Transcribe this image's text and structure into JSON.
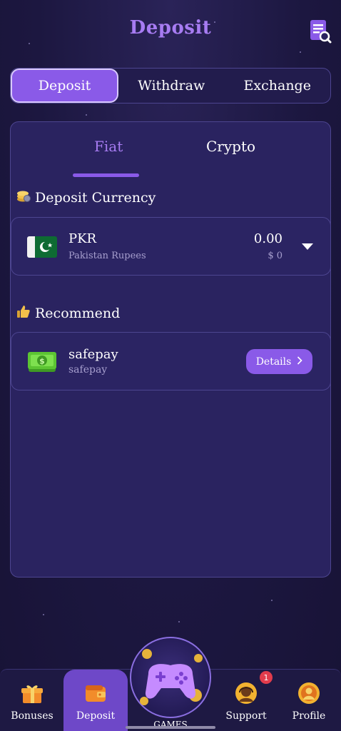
{
  "header": {
    "title": "Deposit",
    "history_icon": "history-search-icon"
  },
  "top_tabs": [
    {
      "label": "Deposit",
      "active": true
    },
    {
      "label": "Withdraw",
      "active": false
    },
    {
      "label": "Exchange",
      "active": false
    }
  ],
  "sub_tabs": [
    {
      "label": "Fiat",
      "active": true
    },
    {
      "label": "Crypto",
      "active": false
    }
  ],
  "currency_section": {
    "title": "Deposit Currency",
    "icon": "coins-icon",
    "selected": {
      "code": "PKR",
      "name": "Pakistan Rupees",
      "amount": "0.00",
      "usd": "$ 0",
      "flag": "pakistan-flag"
    }
  },
  "recommend_section": {
    "title": "Recommend",
    "icon": "thumbs-up-icon",
    "methods": [
      {
        "name": "safepay",
        "sub": "safepay",
        "button": "Details",
        "icon": "cash-icon"
      }
    ]
  },
  "bottom_nav": {
    "items": [
      {
        "label": "Bonuses",
        "icon": "gift-icon"
      },
      {
        "label": "Deposit",
        "icon": "wallet-icon",
        "active": true
      },
      {
        "label": "GAMES",
        "icon": "gamepad-icon"
      },
      {
        "label": "Support",
        "icon": "support-agent-icon",
        "badge": "1"
      },
      {
        "label": "Profile",
        "icon": "profile-icon"
      }
    ]
  },
  "colors": {
    "accent": "#8a5ae8",
    "title": "#a77cf2",
    "background": "#1c1740",
    "panel": "#2a2360"
  }
}
